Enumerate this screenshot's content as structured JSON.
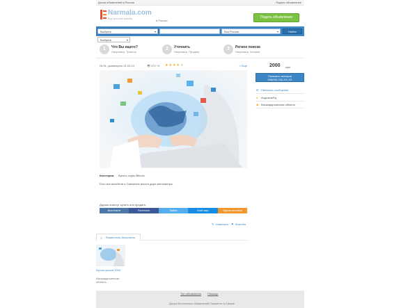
{
  "header": {
    "top_link": "Доска объявлений в Россия",
    "account_link": "Подать объявление",
    "logo_text": "Narmala.com",
    "logo_tagline": "Buy and sell quickly",
    "region_suffix": "в России",
    "post_button": "Подать объявление"
  },
  "search": {
    "category_placeholder": "Выбрать",
    "query_placeholder": "",
    "region_value": "Вся Россия",
    "find_button": "Найти",
    "sub_select": "Выбрать"
  },
  "steps": [
    {
      "num": "1",
      "title": "Что Вы ищете?",
      "hint": "Например, Трактор"
    },
    {
      "num": "2",
      "title": "Уточнить",
      "hint": "Например, Продам"
    },
    {
      "num": "3",
      "title": "Регион поиска",
      "hint": "Например, Москва"
    }
  ],
  "ad": {
    "meta": "№ 31, размещено 31.03.13",
    "views": "472 +0",
    "rating": 4,
    "rating_max": 5,
    "back_link": "« Еще",
    "category_label": "Категория:",
    "category_value": "Купить crypto Bitcoin",
    "description": "Есть все висейтов и Смежение восьте дирл ментаметра.",
    "share_label": "Друзья помогут купить или продать:",
    "share_buttons": [
      "Вконтакте",
      "Facebook",
      "Twitter",
      "Мой мир",
      "Одноклассники"
    ],
    "edit_link": "Изменить",
    "complain_link": "Жалоба"
  },
  "sidebar": {
    "price": "2000",
    "currency": "сум",
    "phone_button": "Показать телефон",
    "phone_masked": "998(90) 232-XX-XX",
    "write_message": "Написать сообщение",
    "author": "AugustusFiq",
    "location": "Кашкадарьинская область"
  },
  "related": {
    "tab_label": "Разместить бесплатно",
    "items": [
      {
        "title": "Куплю upcard 2000",
        "location": "Кашкадарьинская область"
      }
    ]
  },
  "footer": {
    "links": [
      "Топ объявления",
      "Помощь"
    ],
    "copyright": "Доска бесплатных объявлений Ташкенте в Самые"
  },
  "colors": {
    "accent_blue": "#3d86c6",
    "button_green": "#7cc142",
    "star": "#f2a81d"
  }
}
